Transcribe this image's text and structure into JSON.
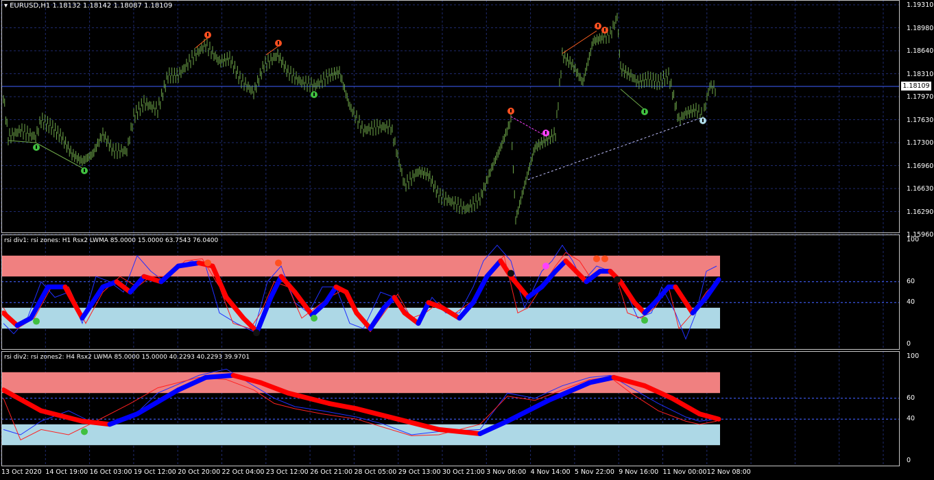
{
  "main": {
    "header": "EURUSD,H1  1.18132 1.18142 1.18087 1.18109",
    "price_labels": [
      "1.19310",
      "1.18980",
      "1.18640",
      "1.18310",
      "1.17970",
      "1.17630",
      "1.17300",
      "1.16960",
      "1.16630",
      "1.16290",
      "1.15960"
    ],
    "current_price": "1.18109"
  },
  "ind1": {
    "header": "rsi div1: rsi zones: H1 Rsx2 LWMA 85.0000 15.0000 63.7543 76.0400",
    "levels": [
      "100",
      "60",
      "40",
      "0"
    ]
  },
  "ind2": {
    "header": "rsi div2: rsi zones2: H4 Rsx2 LWMA 85.0000 15.0000 40.2293 40.2293 39.9701",
    "levels": [
      "100",
      "60",
      "40",
      "0"
    ]
  },
  "time_labels": [
    "13 Oct 2020",
    "14 Oct 19:00",
    "16 Oct 03:00",
    "19 Oct 12:00",
    "20 Oct 20:00",
    "22 Oct 04:00",
    "23 Oct 12:00",
    "26 Oct 21:00",
    "28 Oct 05:00",
    "29 Oct 13:00",
    "30 Oct 21:00",
    "3 Nov 06:00",
    "4 Nov 14:00",
    "5 Nov 22:00",
    "9 Nov 16:00",
    "11 Nov 00:00",
    "12 Nov 08:00"
  ],
  "colors": {
    "candle": "#6fa84a",
    "upper_zone": "#f08080",
    "lower_zone": "#add8e6",
    "rsx_up": "#0000ff",
    "rsx_down": "#ff0000",
    "grid": "#1e2a6e"
  }
}
